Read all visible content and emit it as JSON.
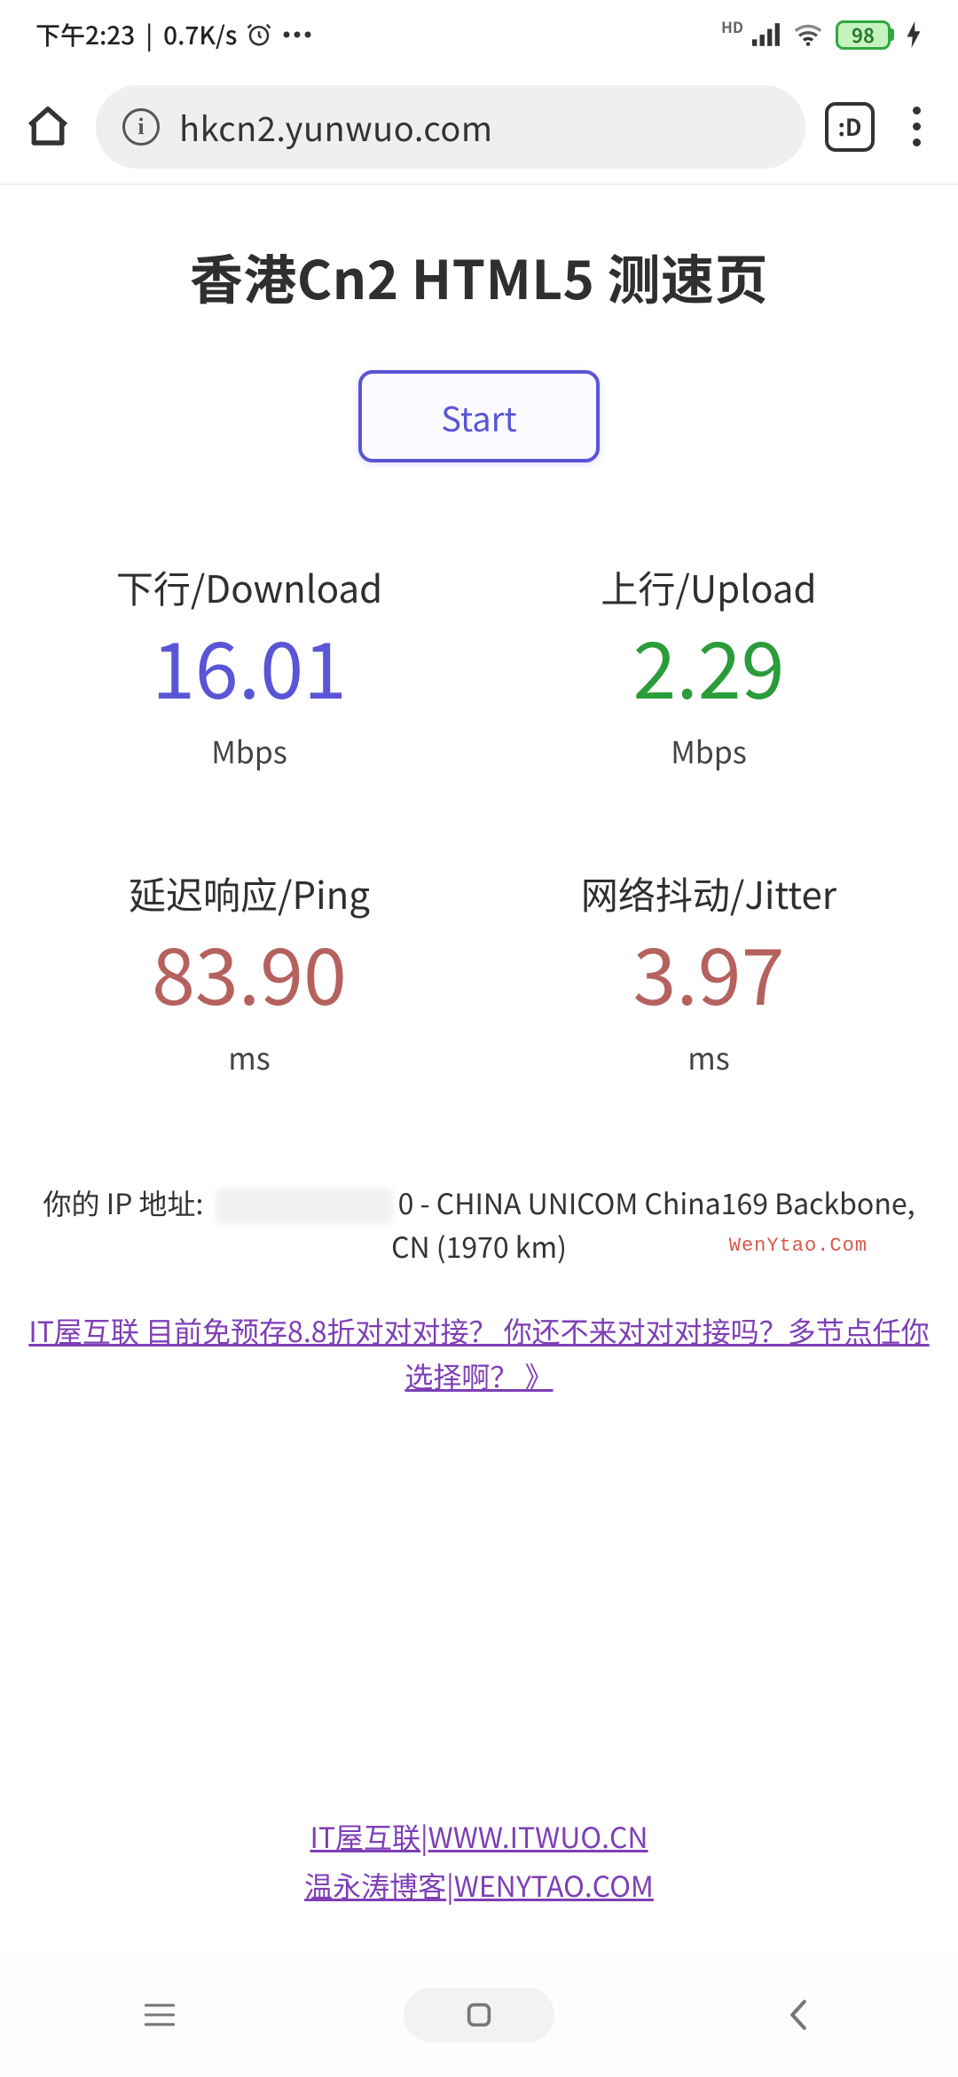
{
  "status_bar": {
    "time": "下午2:23",
    "speed": "0.7K/s",
    "hd": "HD",
    "battery": "98"
  },
  "browser": {
    "url": "hkcn2.yunwuo.com",
    "smile": ":D"
  },
  "page": {
    "title": "香港Cn2 HTML5 测速页",
    "start_label": "Start"
  },
  "metrics": {
    "download": {
      "label": "下行/Download",
      "value": "16.01",
      "unit": "Mbps"
    },
    "upload": {
      "label": "上行/Upload",
      "value": "2.29",
      "unit": "Mbps"
    },
    "ping": {
      "label": "延迟响应/Ping",
      "value": "83.90",
      "unit": "ms"
    },
    "jitter": {
      "label": "网络抖动/Jitter",
      "value": "3.97",
      "unit": "ms"
    }
  },
  "ip": {
    "prefix": "你的 IP 地址:",
    "masked_tail": "0",
    "provider": " - CHINA UNICOM China169 Backbone, CN (1970 km)",
    "watermark": "WenYtao.Com"
  },
  "promo": {
    "text": "IT屋互联 目前免预存8.8折对对对接？ 你还不来对对对接吗？多节点任你选择啊？ 》"
  },
  "footer": {
    "link1_label": "IT屋互联",
    "link1_url_text": "WWW.ITWUO.CN",
    "link2_label": "温永涛博客",
    "link2_url_text": "WENYTAO.COM"
  }
}
